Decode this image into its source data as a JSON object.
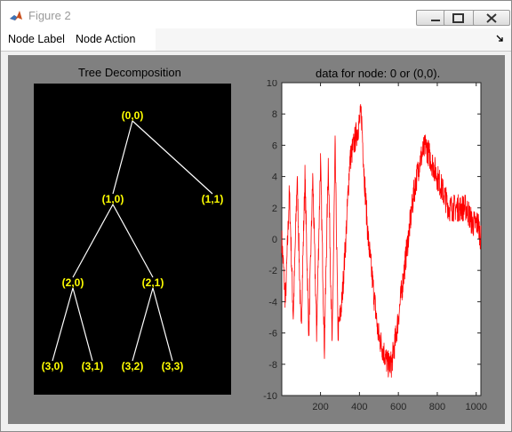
{
  "window": {
    "title": "Figure 2"
  },
  "menubar": {
    "items": [
      "Node Label",
      "Node Action"
    ]
  },
  "tree_panel": {
    "title": "Tree Decomposition",
    "nodes": [
      "(0,0)",
      "(1,0)",
      "(1,1)",
      "(2,0)",
      "(2,1)",
      "(3,0)",
      "(3,1)",
      "(3,2)",
      "(3,3)"
    ],
    "edges": [
      [
        "(0,0)",
        "(1,0)"
      ],
      [
        "(0,0)",
        "(1,1)"
      ],
      [
        "(1,0)",
        "(2,0)"
      ],
      [
        "(1,0)",
        "(2,1)"
      ],
      [
        "(2,0)",
        "(3,0)"
      ],
      [
        "(2,0)",
        "(3,1)"
      ],
      [
        "(2,1)",
        "(3,2)"
      ],
      [
        "(2,1)",
        "(3,3)"
      ]
    ],
    "label_color": "#ffff00",
    "edge_color": "#ffffff"
  },
  "chart_data": {
    "type": "line",
    "title": "data for node: 0 or (0,0).",
    "xlim": [
      1,
      1024
    ],
    "ylim": [
      -10,
      10
    ],
    "xticks": [
      200,
      400,
      600,
      800,
      1000
    ],
    "yticks": [
      -10,
      -8,
      -6,
      -4,
      -2,
      0,
      2,
      4,
      6,
      8,
      10
    ],
    "grid": false,
    "series": [
      {
        "color": "#ff0000",
        "x_range": [
          1,
          1024
        ],
        "description_values": [
          [
            1,
            0
          ],
          [
            20,
            -4
          ],
          [
            40,
            3
          ],
          [
            60,
            -5
          ],
          [
            80,
            4
          ],
          [
            100,
            -6
          ],
          [
            120,
            4
          ],
          [
            140,
            -6
          ],
          [
            160,
            4
          ],
          [
            180,
            -6
          ],
          [
            200,
            5
          ],
          [
            220,
            -7
          ],
          [
            240,
            5
          ],
          [
            260,
            -7
          ],
          [
            275,
            6
          ],
          [
            290,
            -6
          ],
          [
            310,
            -4
          ],
          [
            330,
            0
          ],
          [
            350,
            5
          ],
          [
            370,
            6
          ],
          [
            390,
            7
          ],
          [
            410,
            8
          ],
          [
            425,
            4
          ],
          [
            445,
            0
          ],
          [
            470,
            -3
          ],
          [
            495,
            -6
          ],
          [
            520,
            -7
          ],
          [
            545,
            -8
          ],
          [
            565,
            -8
          ],
          [
            590,
            -6
          ],
          [
            620,
            -3
          ],
          [
            650,
            0
          ],
          [
            680,
            3
          ],
          [
            710,
            5
          ],
          [
            740,
            6
          ],
          [
            770,
            5
          ],
          [
            800,
            4
          ],
          [
            830,
            3
          ],
          [
            860,
            2
          ],
          [
            890,
            2
          ],
          [
            920,
            2
          ],
          [
            950,
            2
          ],
          [
            980,
            1
          ],
          [
            1010,
            1
          ],
          [
            1024,
            0
          ]
        ]
      }
    ]
  },
  "colors": {
    "figure_bg": "#808080",
    "axes_bg": "#ffffff",
    "tree_bg": "#000000",
    "line": "#ff0000"
  }
}
